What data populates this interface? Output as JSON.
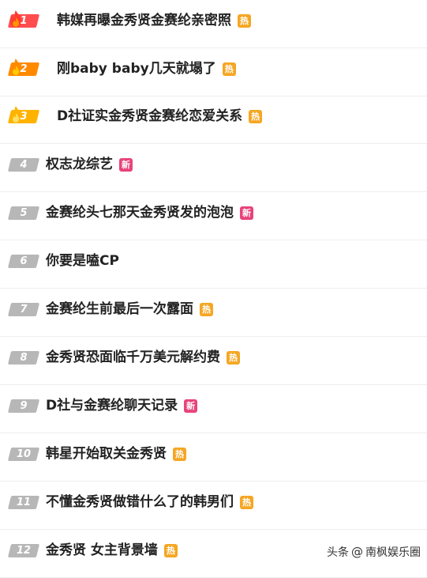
{
  "colors": {
    "rank_top": "#ff4d4f",
    "rank_second": "#ff8a00",
    "rank_third": "#ffb300",
    "rank_normal": "#b7b7b7",
    "badge_hot": "#f5a623",
    "badge_new": "#e8437a"
  },
  "items": [
    {
      "rank": "1",
      "title": "韩媒再曝金秀贤金赛纶亲密照",
      "badge": "热",
      "badge_type": "hot"
    },
    {
      "rank": "2",
      "title": "刚baby baby几天就塌了",
      "badge": "热",
      "badge_type": "hot"
    },
    {
      "rank": "3",
      "title": "D社证实金秀贤金赛纶恋爱关系",
      "badge": "热",
      "badge_type": "hot"
    },
    {
      "rank": "4",
      "title": "权志龙综艺",
      "badge": "新",
      "badge_type": "new"
    },
    {
      "rank": "5",
      "title": "金赛纶头七那天金秀贤发的泡泡",
      "badge": "新",
      "badge_type": "new"
    },
    {
      "rank": "6",
      "title": "你要是嗑CP",
      "badge": "",
      "badge_type": ""
    },
    {
      "rank": "7",
      "title": "金赛纶生前最后一次露面",
      "badge": "热",
      "badge_type": "hot"
    },
    {
      "rank": "8",
      "title": "金秀贤恐面临千万美元解约费",
      "badge": "热",
      "badge_type": "hot"
    },
    {
      "rank": "9",
      "title": "D社与金赛纶聊天记录",
      "badge": "新",
      "badge_type": "new"
    },
    {
      "rank": "10",
      "title": "韩星开始取关金秀贤",
      "badge": "热",
      "badge_type": "hot"
    },
    {
      "rank": "11",
      "title": "不懂金秀贤做错什么了的韩男们",
      "badge": "热",
      "badge_type": "hot"
    },
    {
      "rank": "12",
      "title": "金秀贤 女主背景墙",
      "badge": "热",
      "badge_type": "hot"
    }
  ],
  "watermark": {
    "prefix": "头条",
    "at": "@",
    "account": "南枫娱乐圈"
  }
}
